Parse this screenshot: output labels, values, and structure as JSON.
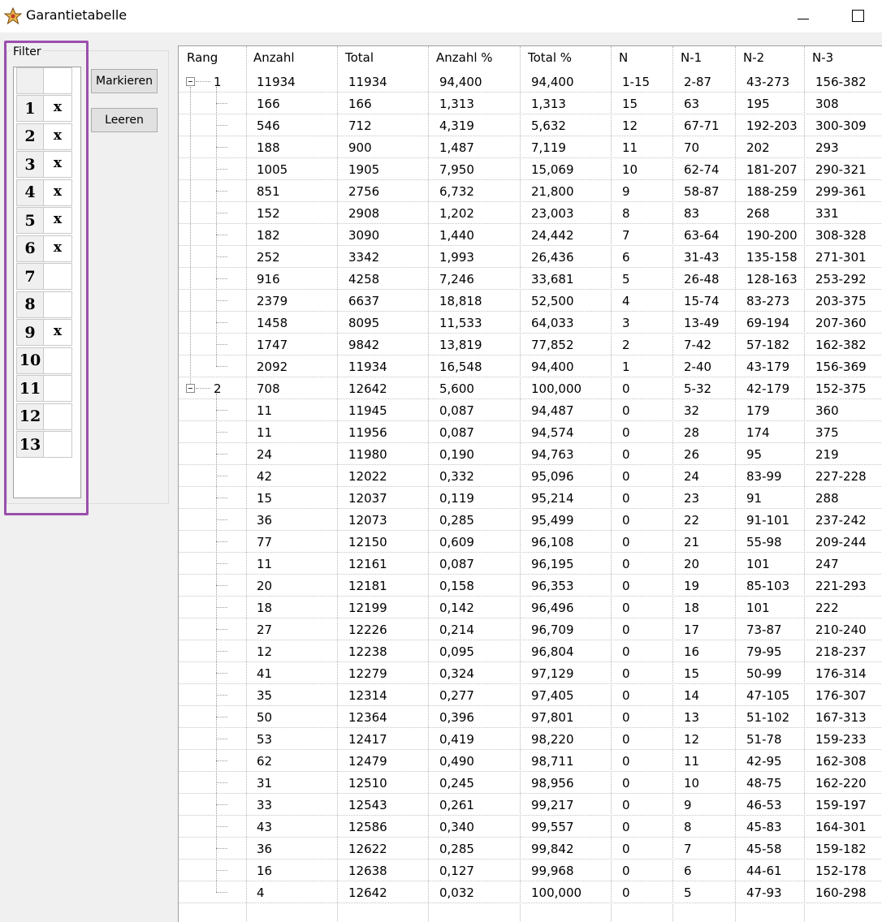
{
  "window": {
    "title": "Garantietabelle",
    "icon": "star-app-icon",
    "controls": [
      "minimize",
      "maximize"
    ]
  },
  "filter": {
    "label": "Filter",
    "header": [
      "",
      ""
    ],
    "rows": [
      {
        "num": "1",
        "val": "x"
      },
      {
        "num": "2",
        "val": "x"
      },
      {
        "num": "3",
        "val": "x"
      },
      {
        "num": "4",
        "val": "x"
      },
      {
        "num": "5",
        "val": "x"
      },
      {
        "num": "6",
        "val": "x"
      },
      {
        "num": "7",
        "val": ""
      },
      {
        "num": "8",
        "val": ""
      },
      {
        "num": "9",
        "val": "x"
      },
      {
        "num": "10",
        "val": ""
      },
      {
        "num": "11",
        "val": ""
      },
      {
        "num": "12",
        "val": ""
      },
      {
        "num": "13",
        "val": ""
      }
    ],
    "highlight_color": "#9b4fac"
  },
  "buttons": {
    "mark": "Markieren",
    "clear": "Leeren"
  },
  "table": {
    "columns": [
      "Rang",
      "Anzahl",
      "Total",
      "Anzahl %",
      "Total %",
      "N",
      "N-1",
      "N-2",
      "N-3"
    ],
    "rows": [
      {
        "rang": "1",
        "expander": true,
        "cells": [
          "11934",
          "11934",
          "94,400",
          "94,400",
          "1-15",
          "2-87",
          "43-273",
          "156-382"
        ]
      },
      {
        "rang": "",
        "cells": [
          "166",
          "166",
          "1,313",
          "1,313",
          "15",
          "63",
          "195",
          "308"
        ]
      },
      {
        "rang": "",
        "cells": [
          "546",
          "712",
          "4,319",
          "5,632",
          "12",
          "67-71",
          "192-203",
          "300-309"
        ]
      },
      {
        "rang": "",
        "cells": [
          "188",
          "900",
          "1,487",
          "7,119",
          "11",
          "70",
          "202",
          "293"
        ]
      },
      {
        "rang": "",
        "cells": [
          "1005",
          "1905",
          "7,950",
          "15,069",
          "10",
          "62-74",
          "181-207",
          "290-321"
        ]
      },
      {
        "rang": "",
        "cells": [
          "851",
          "2756",
          "6,732",
          "21,800",
          "9",
          "58-87",
          "188-259",
          "299-361"
        ]
      },
      {
        "rang": "",
        "cells": [
          "152",
          "2908",
          "1,202",
          "23,003",
          "8",
          "83",
          "268",
          "331"
        ]
      },
      {
        "rang": "",
        "cells": [
          "182",
          "3090",
          "1,440",
          "24,442",
          "7",
          "63-64",
          "190-200",
          "308-328"
        ]
      },
      {
        "rang": "",
        "cells": [
          "252",
          "3342",
          "1,993",
          "26,436",
          "6",
          "31-43",
          "135-158",
          "271-301"
        ]
      },
      {
        "rang": "",
        "cells": [
          "916",
          "4258",
          "7,246",
          "33,681",
          "5",
          "26-48",
          "128-163",
          "253-292"
        ]
      },
      {
        "rang": "",
        "cells": [
          "2379",
          "6637",
          "18,818",
          "52,500",
          "4",
          "15-74",
          "83-273",
          "203-375"
        ]
      },
      {
        "rang": "",
        "cells": [
          "1458",
          "8095",
          "11,533",
          "64,033",
          "3",
          "13-49",
          "69-194",
          "207-360"
        ]
      },
      {
        "rang": "",
        "cells": [
          "1747",
          "9842",
          "13,819",
          "77,852",
          "2",
          "7-42",
          "57-182",
          "162-382"
        ]
      },
      {
        "rang": "",
        "cells": [
          "2092",
          "11934",
          "16,548",
          "94,400",
          "1",
          "2-40",
          "43-179",
          "156-369"
        ]
      },
      {
        "rang": "2",
        "expander": true,
        "cells": [
          "708",
          "12642",
          "5,600",
          "100,000",
          "0",
          "5-32",
          "42-179",
          "152-375"
        ]
      },
      {
        "rang": "",
        "cells": [
          "11",
          "11945",
          "0,087",
          "94,487",
          "0",
          "32",
          "179",
          "360"
        ]
      },
      {
        "rang": "",
        "cells": [
          "11",
          "11956",
          "0,087",
          "94,574",
          "0",
          "28",
          "174",
          "375"
        ]
      },
      {
        "rang": "",
        "cells": [
          "24",
          "11980",
          "0,190",
          "94,763",
          "0",
          "26",
          "95",
          "219"
        ]
      },
      {
        "rang": "",
        "cells": [
          "42",
          "12022",
          "0,332",
          "95,096",
          "0",
          "24",
          "83-99",
          "227-228"
        ]
      },
      {
        "rang": "",
        "cells": [
          "15",
          "12037",
          "0,119",
          "95,214",
          "0",
          "23",
          "91",
          "288"
        ]
      },
      {
        "rang": "",
        "cells": [
          "36",
          "12073",
          "0,285",
          "95,499",
          "0",
          "22",
          "91-101",
          "237-242"
        ]
      },
      {
        "rang": "",
        "cells": [
          "77",
          "12150",
          "0,609",
          "96,108",
          "0",
          "21",
          "55-98",
          "209-244"
        ]
      },
      {
        "rang": "",
        "cells": [
          "11",
          "12161",
          "0,087",
          "96,195",
          "0",
          "20",
          "101",
          "247"
        ]
      },
      {
        "rang": "",
        "cells": [
          "20",
          "12181",
          "0,158",
          "96,353",
          "0",
          "19",
          "85-103",
          "221-293"
        ]
      },
      {
        "rang": "",
        "cells": [
          "18",
          "12199",
          "0,142",
          "96,496",
          "0",
          "18",
          "101",
          "222"
        ]
      },
      {
        "rang": "",
        "cells": [
          "27",
          "12226",
          "0,214",
          "96,709",
          "0",
          "17",
          "73-87",
          "210-240"
        ]
      },
      {
        "rang": "",
        "cells": [
          "12",
          "12238",
          "0,095",
          "96,804",
          "0",
          "16",
          "79-95",
          "218-237"
        ]
      },
      {
        "rang": "",
        "cells": [
          "41",
          "12279",
          "0,324",
          "97,129",
          "0",
          "15",
          "50-99",
          "176-314"
        ]
      },
      {
        "rang": "",
        "cells": [
          "35",
          "12314",
          "0,277",
          "97,405",
          "0",
          "14",
          "47-105",
          "176-307"
        ]
      },
      {
        "rang": "",
        "cells": [
          "50",
          "12364",
          "0,396",
          "97,801",
          "0",
          "13",
          "51-102",
          "167-313"
        ]
      },
      {
        "rang": "",
        "cells": [
          "53",
          "12417",
          "0,419",
          "98,220",
          "0",
          "12",
          "51-78",
          "159-233"
        ]
      },
      {
        "rang": "",
        "cells": [
          "62",
          "12479",
          "0,490",
          "98,711",
          "0",
          "11",
          "42-95",
          "162-308"
        ]
      },
      {
        "rang": "",
        "cells": [
          "31",
          "12510",
          "0,245",
          "98,956",
          "0",
          "10",
          "48-75",
          "162-220"
        ]
      },
      {
        "rang": "",
        "cells": [
          "33",
          "12543",
          "0,261",
          "99,217",
          "0",
          "9",
          "46-53",
          "159-197"
        ]
      },
      {
        "rang": "",
        "cells": [
          "43",
          "12586",
          "0,340",
          "99,557",
          "0",
          "8",
          "45-83",
          "164-301"
        ]
      },
      {
        "rang": "",
        "cells": [
          "36",
          "12622",
          "0,285",
          "99,842",
          "0",
          "7",
          "45-58",
          "159-182"
        ]
      },
      {
        "rang": "",
        "cells": [
          "16",
          "12638",
          "0,127",
          "99,968",
          "0",
          "6",
          "44-61",
          "152-178"
        ]
      },
      {
        "rang": "",
        "cells": [
          "4",
          "12642",
          "0,032",
          "100,000",
          "0",
          "5",
          "47-93",
          "160-298"
        ]
      }
    ]
  }
}
